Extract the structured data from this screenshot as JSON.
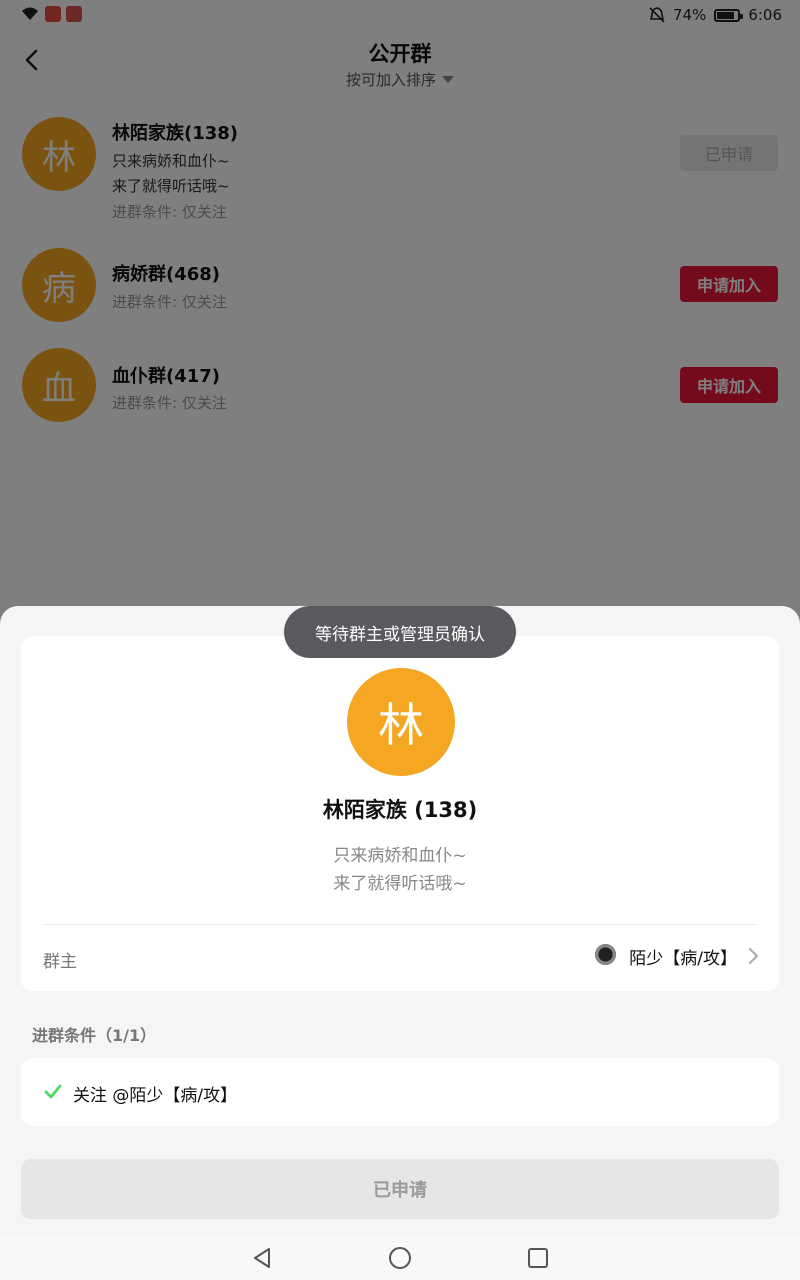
{
  "status_bar": {
    "battery_text": "74%",
    "battery_level": 0.74,
    "time": "6:06",
    "icons": [
      "wifi-icon",
      "app-notification-icon",
      "app-notification-icon",
      "mute-icon",
      "battery-icon"
    ]
  },
  "header": {
    "title": "公开群",
    "sort_label": "按可加入排序"
  },
  "groups": [
    {
      "avatar_char": "林",
      "name": "林陌家族(138)",
      "desc_lines": [
        "只来病娇和血仆~",
        "来了就得听话哦~"
      ],
      "condition": "进群条件: 仅关注",
      "button": "已申请",
      "button_state": "applied"
    },
    {
      "avatar_char": "病",
      "name": "病娇群(468)",
      "desc_lines": [],
      "condition": "进群条件: 仅关注",
      "button": "申请加入",
      "button_state": "join"
    },
    {
      "avatar_char": "血",
      "name": "血仆群(417)",
      "desc_lines": [],
      "condition": "进群条件: 仅关注",
      "button": "申请加入",
      "button_state": "join"
    }
  ],
  "sheet": {
    "toast": "等待群主或管理员确认",
    "avatar_char": "林",
    "group_name": "林陌家族 (138)",
    "desc_lines": [
      "只来病娇和血仆~",
      "来了就得听话哦~"
    ],
    "owner_label": "群主",
    "owner_name": "陌少【病/攻】",
    "conditions_title": "进群条件（1/1）",
    "condition_item": "关注 @陌少【病/攻】",
    "applied_button": "已申请"
  },
  "colors": {
    "avatar_orange": "#f5a623",
    "join_red": "#e8163a",
    "check_green": "#4cd964"
  },
  "nav_bar": {
    "icons": [
      "back-triangle-icon",
      "home-circle-icon",
      "recents-square-icon"
    ]
  }
}
